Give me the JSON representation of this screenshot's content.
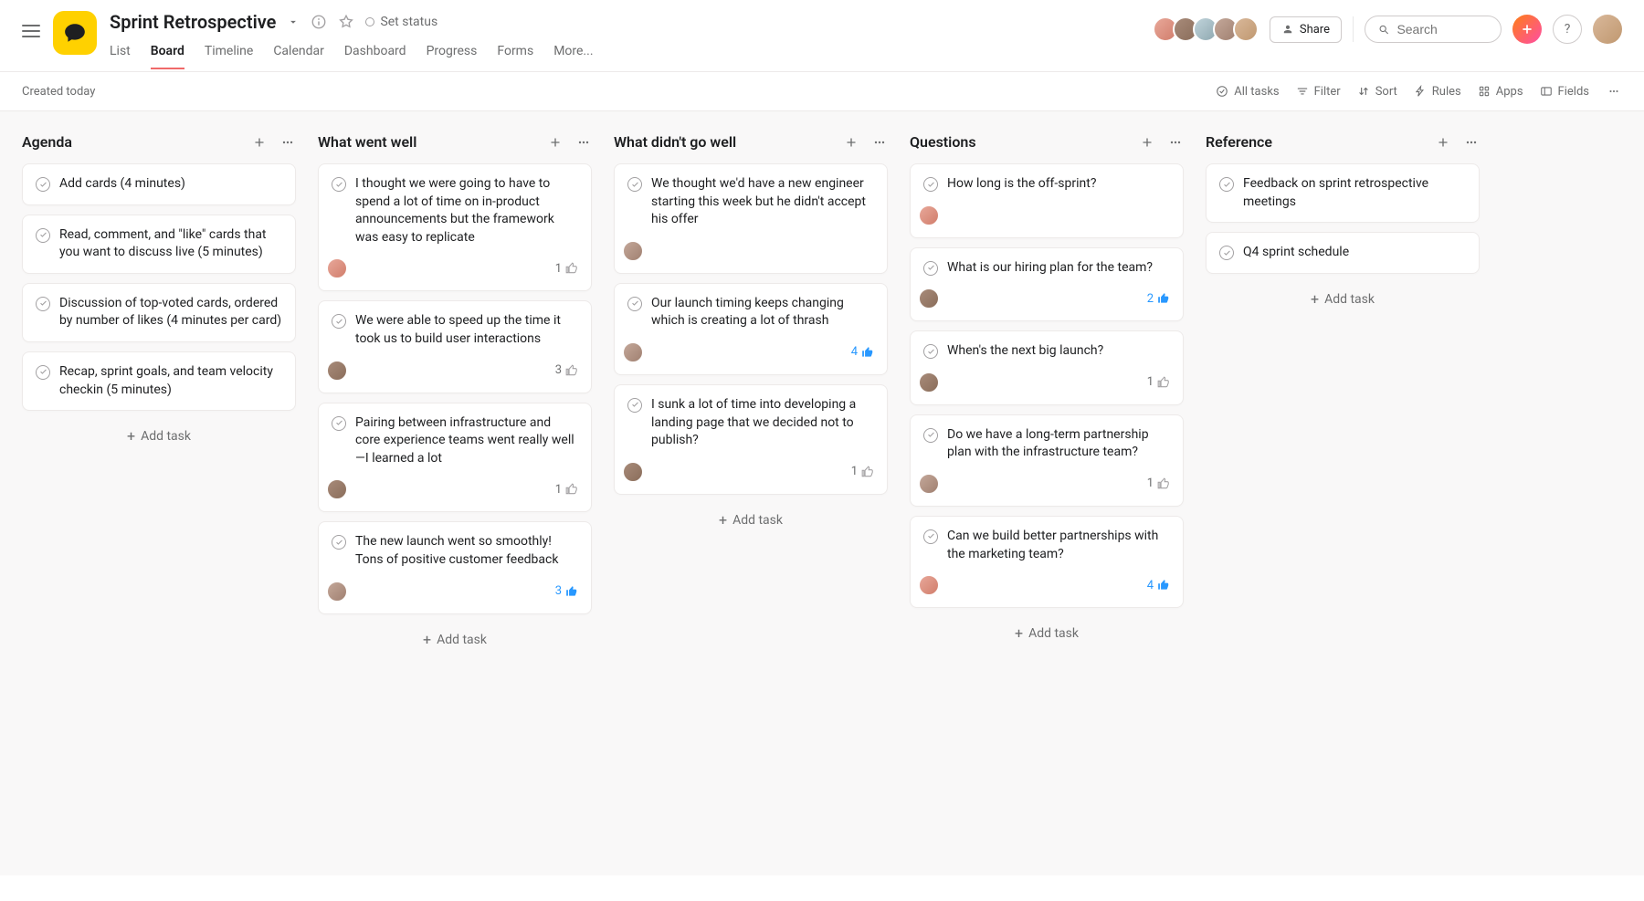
{
  "header": {
    "project_title": "Sprint Retrospective",
    "set_status_label": "Set status",
    "share_label": "Share",
    "search_placeholder": "Search"
  },
  "tabs": {
    "list": "List",
    "board": "Board",
    "timeline": "Timeline",
    "calendar": "Calendar",
    "dashboard": "Dashboard",
    "progress": "Progress",
    "forms": "Forms",
    "more": "More..."
  },
  "toolbar": {
    "created": "Created today",
    "all_tasks": "All tasks",
    "filter": "Filter",
    "sort": "Sort",
    "rules": "Rules",
    "apps": "Apps",
    "fields": "Fields"
  },
  "add_task_label": "Add task",
  "columns": [
    {
      "title": "Agenda",
      "cards": [
        {
          "text": "Add cards (4 minutes)"
        },
        {
          "text": "Read, comment, and \"like\" cards that you want to discuss live (5 minutes)"
        },
        {
          "text": "Discussion of top-voted cards, ordered by number of likes (4 minutes per card)"
        },
        {
          "text": "Recap, sprint goals, and team velocity checkin (5 minutes)"
        }
      ]
    },
    {
      "title": "What went well",
      "cards": [
        {
          "text": "I thought we were going to have to spend a lot of time on in-product announcements but the framework was easy to replicate",
          "assignee": "av1",
          "likes": "1",
          "liked": false
        },
        {
          "text": "We were able to speed up the time it took us to build user interactions",
          "assignee": "av2",
          "likes": "3",
          "liked": false
        },
        {
          "text": "Pairing between infrastructure and core experience teams went really well—I learned a lot",
          "assignee": "av2",
          "likes": "1",
          "liked": false
        },
        {
          "text": "The new launch went so smoothly! Tons of positive customer feedback",
          "assignee": "av4",
          "likes": "3",
          "liked": true
        }
      ]
    },
    {
      "title": "What didn't go well",
      "cards": [
        {
          "text": "We thought we'd have a new engineer starting this week but he didn't accept his offer",
          "assignee": "av4"
        },
        {
          "text": "Our launch timing keeps changing which is creating a lot of thrash",
          "assignee": "av4",
          "likes": "4",
          "liked": true
        },
        {
          "text": "I sunk a lot of time into developing a landing page that we decided not to publish?",
          "assignee": "av2",
          "likes": "1",
          "liked": false
        }
      ]
    },
    {
      "title": "Questions",
      "cards": [
        {
          "text": "How long is the off-sprint?",
          "assignee": "av1"
        },
        {
          "text": "What is our hiring plan for the team?",
          "assignee": "av2",
          "likes": "2",
          "liked": true
        },
        {
          "text": "When's the next big launch?",
          "assignee": "av2",
          "likes": "1",
          "liked": false
        },
        {
          "text": "Do we have a long-term partnership plan with the infrastructure team?",
          "assignee": "av4",
          "likes": "1",
          "liked": false
        },
        {
          "text": "Can we build better partnerships with the marketing team?",
          "assignee": "av1",
          "likes": "4",
          "liked": true
        }
      ]
    },
    {
      "title": "Reference",
      "cards": [
        {
          "text": "Feedback on sprint retrospective meetings"
        },
        {
          "text": "Q4 sprint schedule"
        }
      ]
    }
  ]
}
